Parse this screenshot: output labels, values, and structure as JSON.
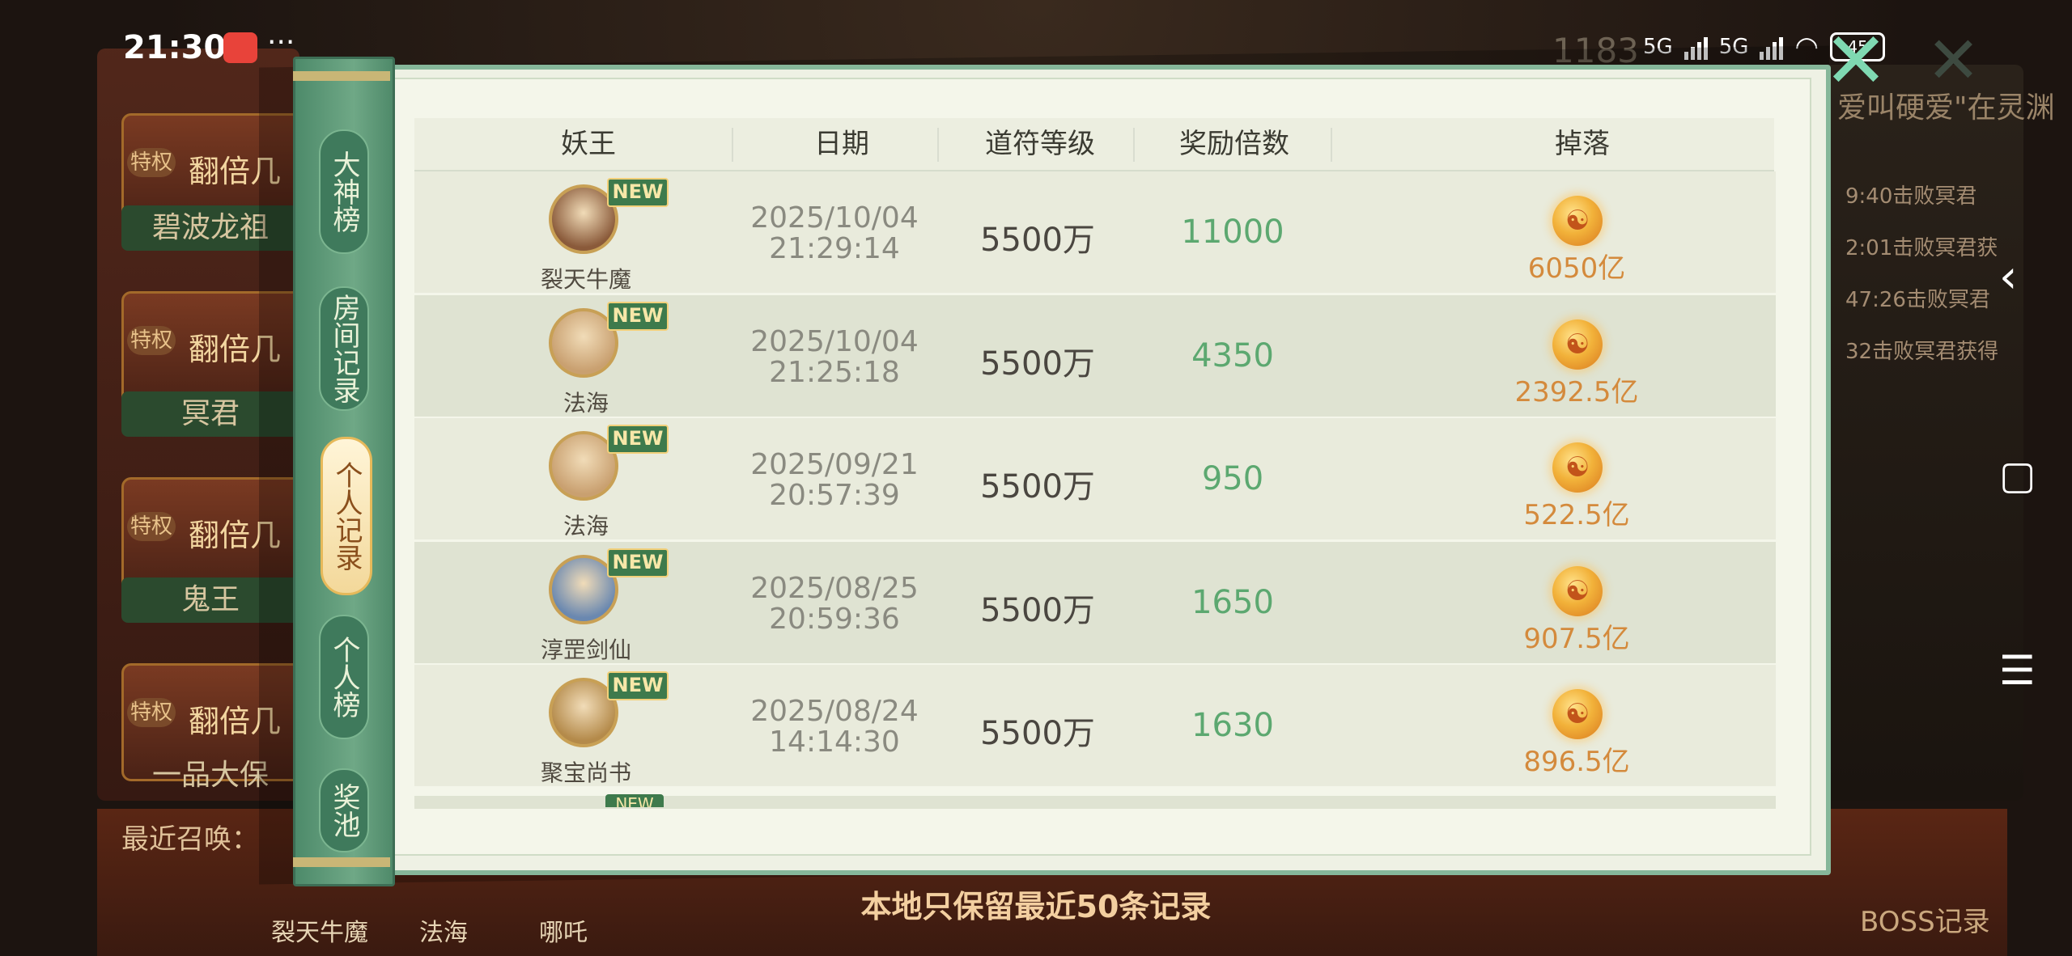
{
  "status_bar": {
    "time": "21:30",
    "dots": "···",
    "network_1": "5G",
    "network_2": "5G",
    "battery": "45"
  },
  "background": {
    "counter": "1183",
    "left_names": [
      "碧波龙祖",
      "冥君",
      "鬼王",
      "一品大保"
    ],
    "privilege_label": "特权",
    "double_label": "翻倍几",
    "right_title": "爱叫硬爱\"在灵渊",
    "right_lines": [
      "9:40击败冥君",
      "2:01击败冥君获",
      "47:26击败冥君",
      "32击败冥君获得"
    ],
    "recent_summon_label": "最近召唤：",
    "recent_names": [
      "裂天牛魔",
      "法海",
      "哪吒"
    ],
    "boss_record_label": "BOSS记录"
  },
  "tabs": [
    {
      "label": "大神榜",
      "active": false
    },
    {
      "label": "房间记录",
      "active": false
    },
    {
      "label": "个人记录",
      "active": true
    },
    {
      "label": "个人榜",
      "active": false
    },
    {
      "label": "奖池",
      "active": false
    }
  ],
  "table": {
    "headers": [
      "妖王",
      "日期",
      "道符等级",
      "奖励倍数",
      "掉落"
    ],
    "new_badge": "NEW",
    "rows": [
      {
        "boss": "裂天牛魔",
        "date": "2025/10/04",
        "time": "21:29:14",
        "level": "5500万",
        "multiplier": "11000",
        "drop": "6050亿",
        "avatar_color": "#8a5a3a"
      },
      {
        "boss": "法海",
        "date": "2025/10/04",
        "time": "21:25:18",
        "level": "5500万",
        "multiplier": "4350",
        "drop": "2392.5亿",
        "avatar_color": "#c9a070"
      },
      {
        "boss": "法海",
        "date": "2025/09/21",
        "time": "20:57:39",
        "level": "5500万",
        "multiplier": "950",
        "drop": "522.5亿",
        "avatar_color": "#c9a070"
      },
      {
        "boss": "淳罡剑仙",
        "date": "2025/08/25",
        "time": "20:59:36",
        "level": "5500万",
        "multiplier": "1650",
        "drop": "907.5亿",
        "avatar_color": "#6a88b0"
      },
      {
        "boss": "聚宝尚书",
        "date": "2025/08/24",
        "time": "14:14:30",
        "level": "5500万",
        "multiplier": "1630",
        "drop": "896.5亿",
        "avatar_color": "#b48a4a"
      }
    ]
  },
  "footer_note": "本地只保留最近50条记录"
}
